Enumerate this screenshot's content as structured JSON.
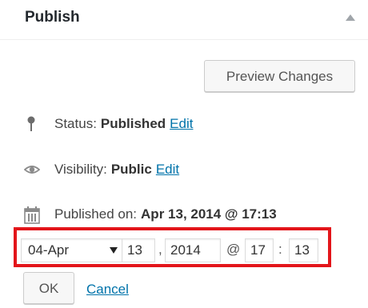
{
  "header": {
    "title": "Publish"
  },
  "preview_button": "Preview Changes",
  "status": {
    "label": "Status:",
    "value": "Published",
    "edit": "Edit",
    "icon": "pin-icon"
  },
  "visibility": {
    "label": "Visibility:",
    "value": "Public",
    "edit": "Edit",
    "icon": "eye-icon"
  },
  "published": {
    "label": "Published on:",
    "value": "Apr 13, 2014 @ 17:13",
    "icon": "calendar-icon"
  },
  "datetime": {
    "month": "04-Apr",
    "day": "13",
    "year": "2014",
    "hour": "17",
    "minute": "13",
    "comma": ",",
    "at": "@",
    "colon": ":",
    "highlight_color": "#e3151a"
  },
  "actions": {
    "ok": "OK",
    "cancel": "Cancel"
  },
  "colors": {
    "link": "#0073aa",
    "highlight": "#e3151a"
  }
}
